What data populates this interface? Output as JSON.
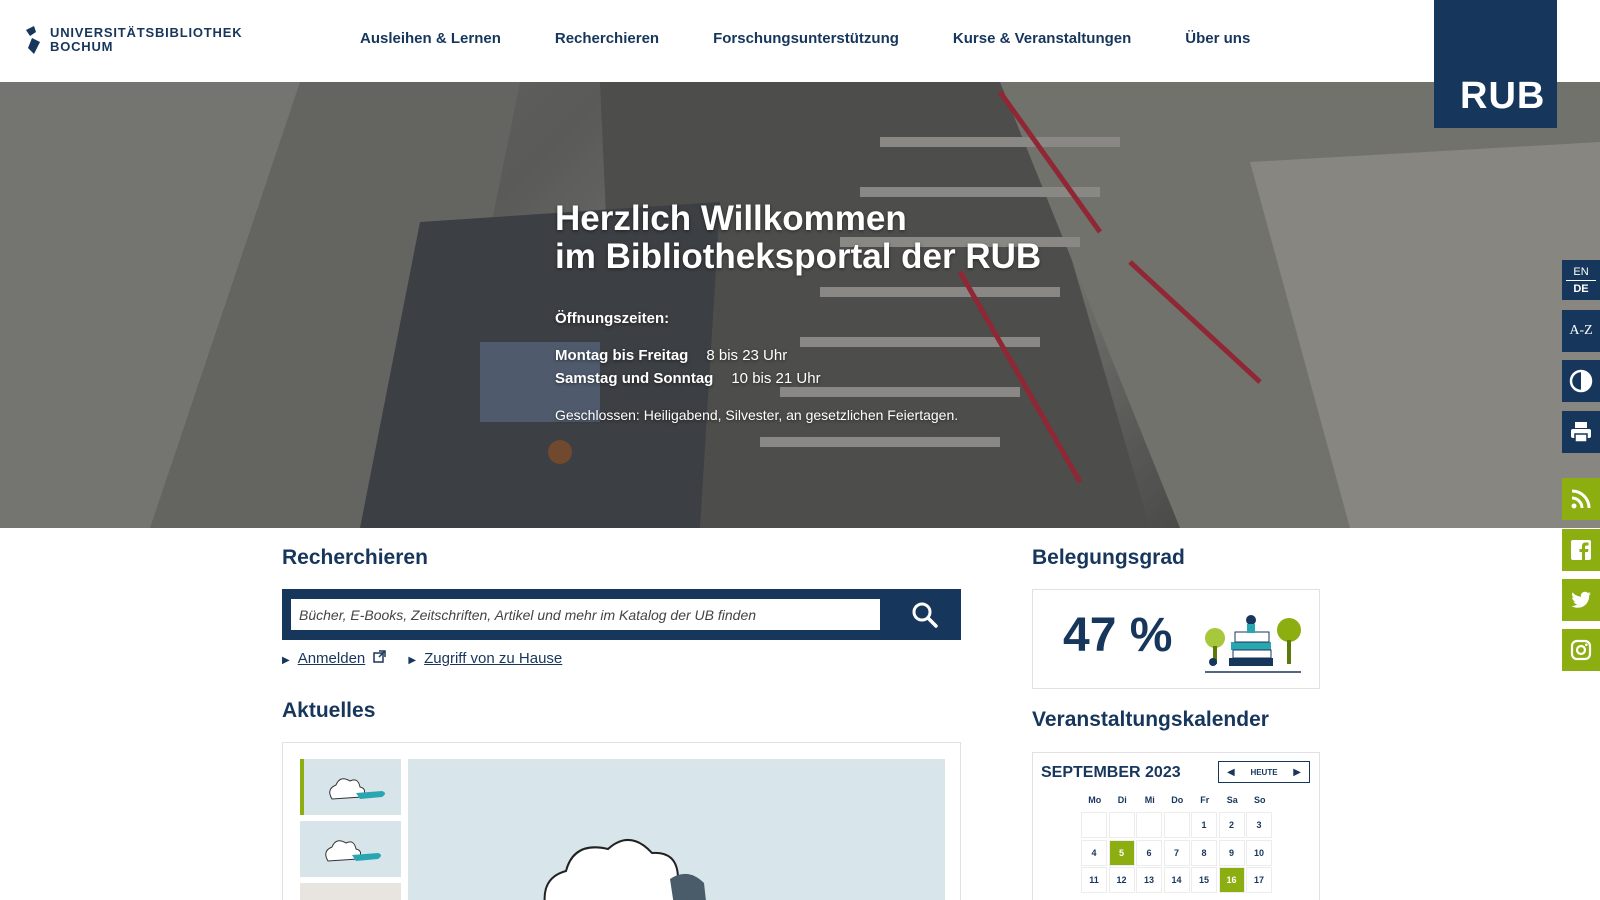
{
  "header": {
    "logo_line1": "UNIVERSITÄTSBIBLIOTHEK",
    "logo_line2": "BOCHUM",
    "nav": [
      "Ausleihen & Lernen",
      "Recherchieren",
      "Forschungsunterstützung",
      "Kurse & Veranstaltungen",
      "Über uns"
    ],
    "rub_logo": "RUB"
  },
  "hero": {
    "title_line1": "Herzlich Willkommen",
    "title_line2": "im Bibliotheksportal der RUB",
    "hours_heading": "Öffnungszeiten:",
    "weekday_label": "Montag bis Freitag",
    "weekday_hours": "8 bis 23 Uhr",
    "weekend_label": "Samstag und Sonntag",
    "weekend_hours": "10 bis 21 Uhr",
    "closed_note": "Geschlossen: Heiligabend, Silvester, an gesetzlichen Feiertagen."
  },
  "sidebar": {
    "lang_en": "EN",
    "lang_de": "DE",
    "az": "A-Z",
    "icons": [
      "contrast-icon",
      "print-icon",
      "rss-icon",
      "facebook-icon",
      "twitter-icon",
      "instagram-icon"
    ]
  },
  "search": {
    "heading": "Recherchieren",
    "placeholder": "Bücher, E-Books, Zeitschriften, Artikel und mehr im Katalog der UB finden",
    "login_link": "Anmelden",
    "remote_link": "Zugriff von zu Hause"
  },
  "news": {
    "heading": "Aktuelles"
  },
  "occupancy": {
    "heading": "Belegungsgrad",
    "percent": 47,
    "value_label": "47 %"
  },
  "calendar": {
    "heading": "Veranstaltungskalender",
    "month": "SEPTEMBER 2023",
    "today": "HEUTE",
    "weekdays": [
      "Mo",
      "Di",
      "Mi",
      "Do",
      "Fr",
      "Sa",
      "So"
    ],
    "rows": [
      [
        "",
        "",
        "",
        "",
        "1",
        "2",
        "3"
      ],
      [
        "4",
        "5",
        "6",
        "7",
        "8",
        "9",
        "10"
      ],
      [
        "11",
        "12",
        "13",
        "14",
        "15",
        "16",
        "17"
      ]
    ],
    "event_days": [
      "5",
      "16"
    ]
  },
  "colors": {
    "brand": "#17365c",
    "accent": "#8dae10"
  }
}
